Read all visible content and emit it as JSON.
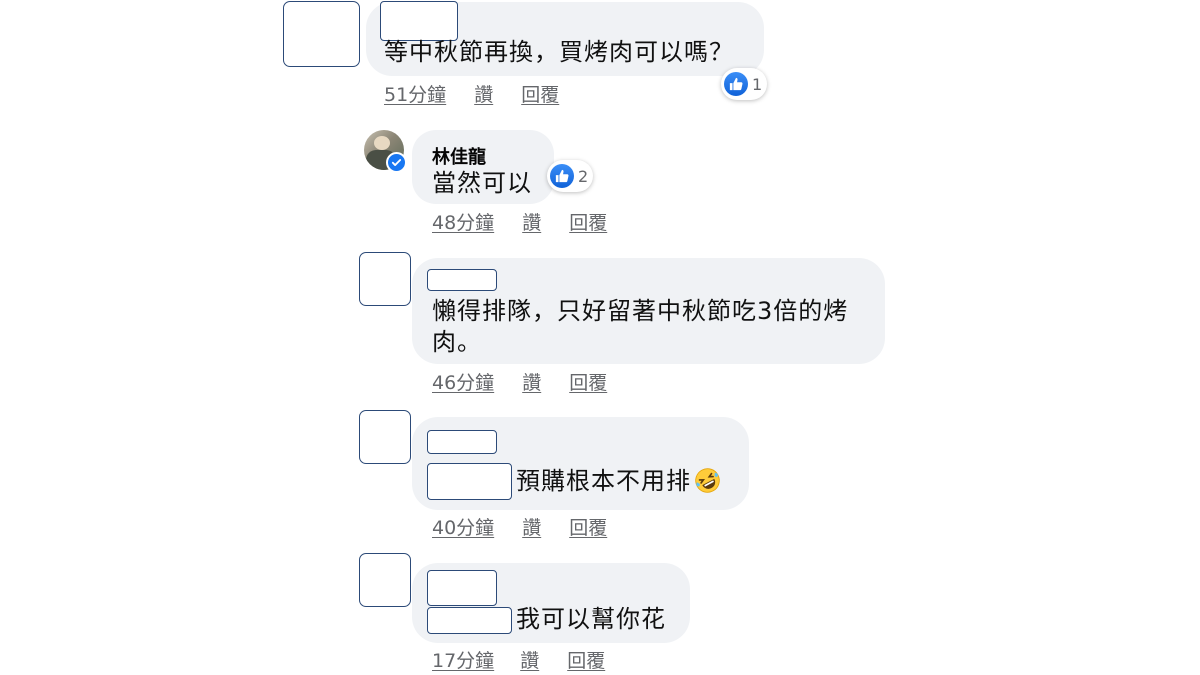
{
  "comments": [
    {
      "text": "等中秋節再換，買烤肉可以嗎？",
      "time": "51分鐘",
      "like_label": "讚",
      "reply_label": "回覆",
      "reaction_count": "1"
    },
    {
      "author": "林佳龍",
      "verified_icon": "verified-badge-icon",
      "text": "當然可以",
      "time": "48分鐘",
      "like_label": "讚",
      "reply_label": "回覆",
      "reaction_count": "2"
    },
    {
      "text_line1": "懶得排隊，只好留著中秋節吃3倍的烤",
      "text_line2": "肉。",
      "time": "46分鐘",
      "like_label": "讚",
      "reply_label": "回覆"
    },
    {
      "text": "預購根本不用排",
      "emoji": "rolling-on-floor-laughing-emoji",
      "time": "40分鐘",
      "like_label": "讚",
      "reply_label": "回覆"
    },
    {
      "text": "我可以幫你花",
      "time": "17分鐘",
      "like_label": "讚",
      "reply_label": "回覆"
    }
  ],
  "colors": {
    "bubble": "#f0f2f5",
    "like_blue": "#1877f2",
    "meta_gray": "#65676b",
    "redaction_border": "#2c4a78"
  }
}
